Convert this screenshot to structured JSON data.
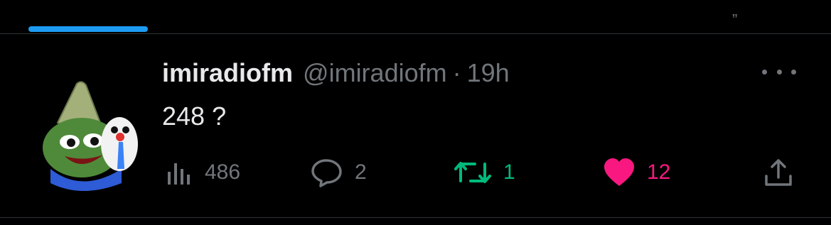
{
  "tweet": {
    "display_name": "imiradiofm",
    "handle": "@imiradiofm",
    "separator": "·",
    "time": "19h",
    "text": "248 ?",
    "actions": {
      "views": "486",
      "replies": "2",
      "retweets": "1",
      "likes": "12"
    }
  },
  "colors": {
    "background": "#000000",
    "text_primary": "#e7e9ea",
    "text_secondary": "#71767b",
    "accent_blue": "#1d9bf0",
    "retweet_green": "#00ba7c",
    "like_pink": "#f91880"
  },
  "icons": {
    "views": "bar-chart-icon",
    "reply": "speech-bubble-icon",
    "retweet": "retweet-arrows-icon",
    "like": "heart-filled-icon",
    "share": "upload-share-icon",
    "more": "more-dots-icon"
  }
}
